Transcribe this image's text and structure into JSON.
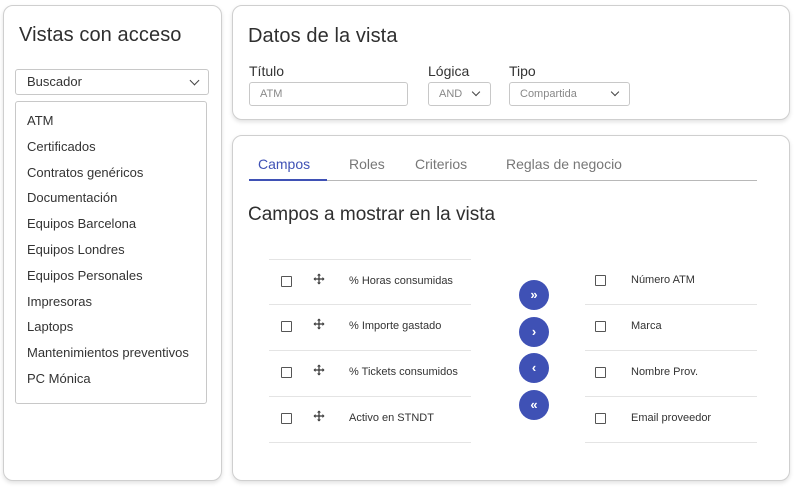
{
  "views_panel": {
    "title": "Vistas con acceso",
    "search_select": "Buscador",
    "items": [
      "ATM",
      "Certificados",
      "Contratos genéricos",
      "Documentación",
      "Equipos Barcelona",
      "Equipos Londres",
      "Equipos Personales",
      "Impresoras",
      "Laptops",
      "Mantenimientos preventivos",
      "PC Mónica"
    ]
  },
  "view_data": {
    "title": "Datos de la vista",
    "titulo_label": "Título",
    "titulo_value": "ATM",
    "logica_label": "Lógica",
    "logica_value": "AND",
    "tipo_label": "Tipo",
    "tipo_value": "Compartida"
  },
  "tabs": [
    "Campos",
    "Roles",
    "Criterios",
    "Reglas de negocio"
  ],
  "active_tab": "Campos",
  "fields_section": {
    "title": "Campos a mostrar en la vista",
    "available_fields": [
      "% Horas consumidas",
      "% Importe gastado",
      "% Tickets consumidos",
      "Activo en STNDT"
    ],
    "selected_fields": [
      "Número ATM",
      "Marca",
      "Nombre Prov.",
      "Email proveedor"
    ],
    "buttons": {
      "move_all_right": "»",
      "move_right": "›",
      "move_left": "‹",
      "move_all_left": "«"
    }
  },
  "colors": {
    "accent": "#3f51b5",
    "border": "#cfcfcf",
    "text": "#333333"
  },
  "icons": {
    "drag": "drag-move-icon",
    "dropdown": "chevron-down-icon"
  }
}
